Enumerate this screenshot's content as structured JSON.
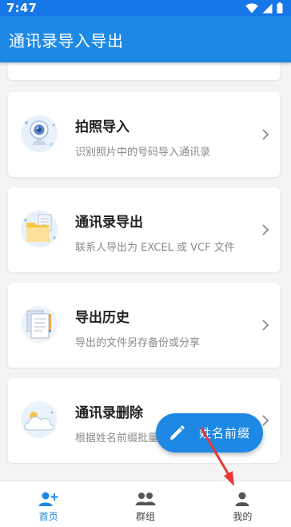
{
  "status_bar": {
    "time": "7:47",
    "icons": [
      "wifi-icon",
      "signal-icon",
      "battery-icon"
    ]
  },
  "app_bar": {
    "title": "通讯录导入导出"
  },
  "cards": [
    {
      "title": "拍照导入",
      "desc": "识别照片中的号码导入通讯录",
      "icon": "camera-icon"
    },
    {
      "title": "通讯录导出",
      "desc": "联系人导出为 EXCEL 或 VCF 文件",
      "icon": "folder-icon"
    },
    {
      "title": "导出历史",
      "desc": "导出的文件另存备份或分享",
      "icon": "documents-icon"
    },
    {
      "title": "通讯录删除",
      "desc": "根据姓名前缀批量",
      "icon": "cloud-icon"
    }
  ],
  "fab": {
    "label": "姓名前缀",
    "icon": "pencil-icon"
  },
  "bottom_nav": [
    {
      "label": "首页",
      "icon": "add-person-icon",
      "active": true
    },
    {
      "label": "群组",
      "icon": "group-icon",
      "active": false
    },
    {
      "label": "我的",
      "icon": "person-icon",
      "active": false
    }
  ],
  "colors": {
    "primary": "#1e88e5",
    "status_bar": "#1677e8",
    "background": "#f4f4f4",
    "annotation_arrow": "#e53935"
  }
}
